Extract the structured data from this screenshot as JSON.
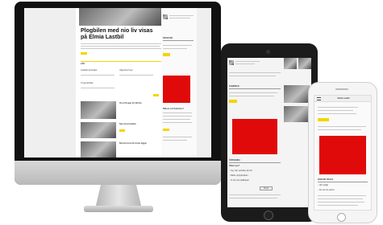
{
  "desktop": {
    "headline_line1": "Plogbilen med nio liv visas",
    "headline_line2": "på Elmia Lastbil",
    "teasers": [
      "Lastbilar behandlar",
      "Vägverket byter",
      "Tunga lastbilar",
      "Visst förvagn för 900 km",
      "Nya stora lastbilar",
      "Den utsmutsade lastbilen",
      "Burnett stora till vertex lagger"
    ],
    "sidebar_label": "RECEIVED",
    "poll_heading": "Bilkom och Radiohus?",
    "read_more": "LÄS"
  },
  "tablet": {
    "sections": [
      "KAMPMAN",
      "FÖRNAMNA"
    ],
    "poll_heading": "Vilken byn?",
    "poll_options": [
      "Nej, han sprödder på de?",
      "Bättre uppfylla Elder",
      "Vi har inte Fjällhöjden"
    ],
    "vote_label": "Rösta"
  },
  "phone": {
    "title": "Elmia Lastbil",
    "section": "ROSADE FRÅGA",
    "poll_options": [
      "Allt möjligt",
      "De vet inte sämre"
    ]
  }
}
